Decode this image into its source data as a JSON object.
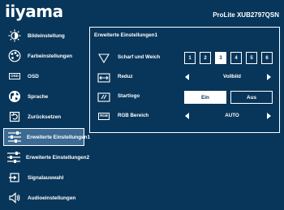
{
  "header": {
    "logo": "iiyama",
    "model": "ProLite XUB2797QSN"
  },
  "sidebar": {
    "items": [
      {
        "label": "Bildeinstellung",
        "icon": "brightness-icon"
      },
      {
        "label": "Farbeinstellungen",
        "icon": "color-palette-icon"
      },
      {
        "label": "OSD",
        "icon": "osd-icon",
        "icon_text": "OSD"
      },
      {
        "label": "Sprache",
        "icon": "globe-icon"
      },
      {
        "label": "Zurücksetzen",
        "icon": "reset-icon"
      },
      {
        "label": "Erweiterte Einstellungen1",
        "icon": "sliders-icon",
        "active": true
      },
      {
        "label": "Erweiterte Einstellungen2",
        "icon": "sliders-icon"
      },
      {
        "label": "Signalauswahl",
        "icon": "input-icon"
      },
      {
        "label": "Audioeinstellungen",
        "icon": "speaker-icon"
      }
    ]
  },
  "panel": {
    "title": "Erweiterte Einstellungen1",
    "rows": {
      "sharpness": {
        "label": "Scharf und Weich",
        "icon": "triangle-down-icon",
        "options": [
          "1",
          "2",
          "3",
          "4",
          "5",
          "6"
        ],
        "selected": "3"
      },
      "reduz": {
        "label": "Reduz",
        "icon": "resize-icon",
        "value": "Vollbild"
      },
      "startlogo": {
        "label": "Startlogo",
        "icon": "logo-icon",
        "options": [
          "Ein",
          "Aus"
        ],
        "selected": "Ein"
      },
      "rgb": {
        "label": "RGB Bereich",
        "icon": "rgb-icon",
        "icon_text": "RGB",
        "value": "AUTO"
      }
    }
  },
  "colors": {
    "background": "#08365a",
    "active_item": "#3b6a92",
    "foreground": "#ffffff"
  }
}
